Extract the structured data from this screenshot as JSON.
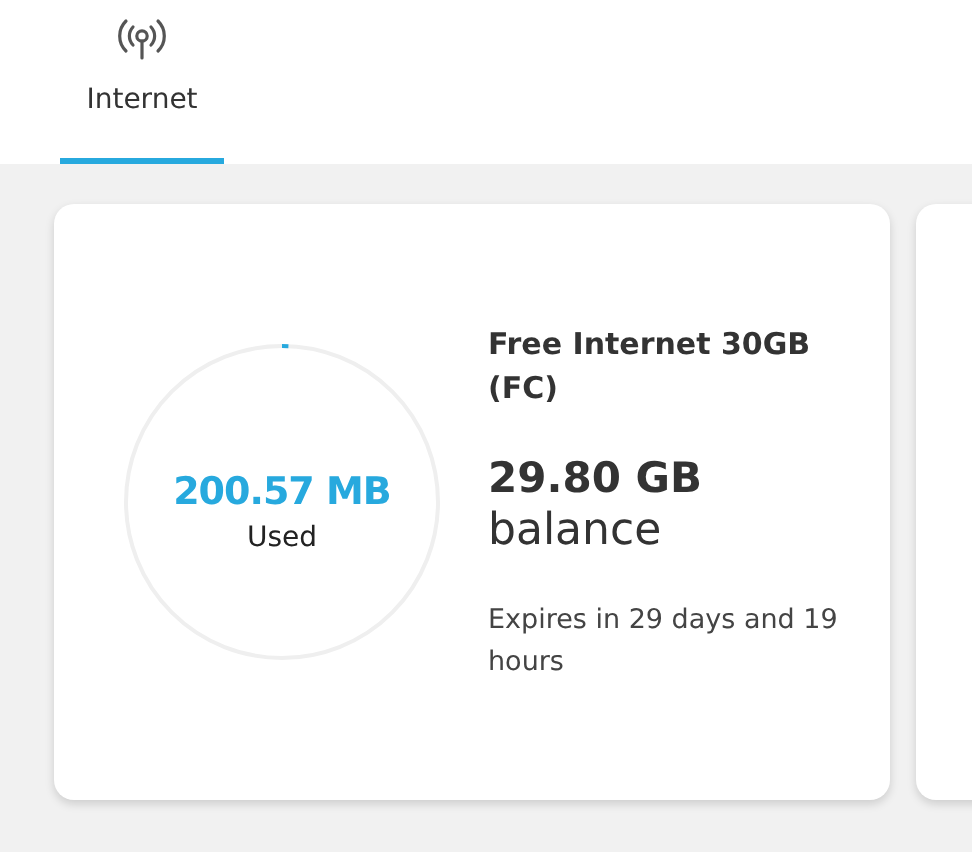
{
  "tabs": [
    {
      "label": "Internet",
      "selected": true
    }
  ],
  "plan": {
    "used": "200.57 MB",
    "used_label": "Used",
    "level": 0.0066,
    "name": "Free Internet 30GB (FC)",
    "balance": "29.80 GB",
    "balance_label": "balance",
    "expiry": "Expires in 29 days and 19 hours"
  }
}
